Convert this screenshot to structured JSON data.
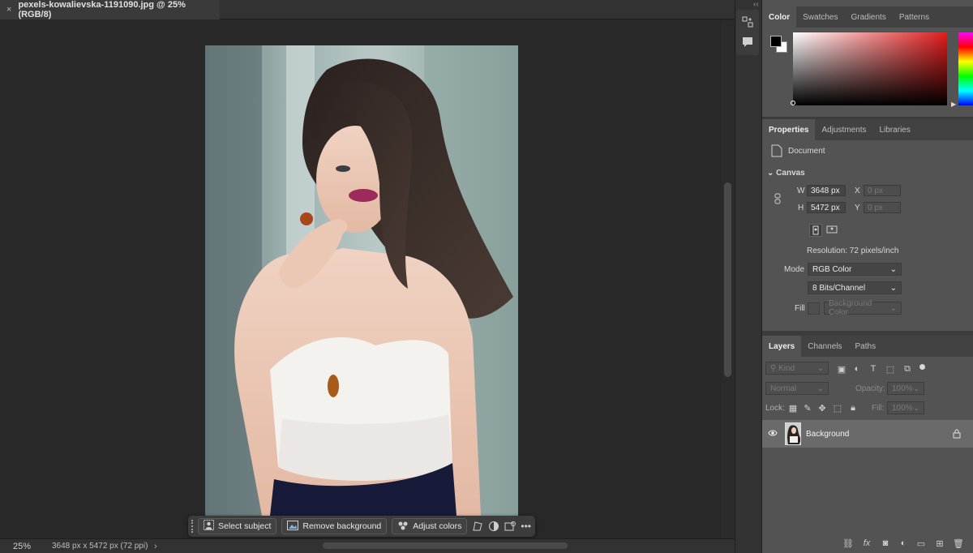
{
  "document_tab": {
    "close_glyph": "×",
    "title": "pexels-kowalievska-1191090.jpg @ 25% (RGB/8)"
  },
  "taskbar": {
    "select_subject": "Select subject",
    "remove_background": "Remove background",
    "adjust_colors": "Adjust colors",
    "more": "•••"
  },
  "statusbar": {
    "zoom": "25%",
    "doc_info": "3648 px x 5472 px (72 ppi)",
    "arrow": "›"
  },
  "color_panel": {
    "tabs": [
      "Color",
      "Swatches",
      "Gradients",
      "Patterns"
    ],
    "hue_color": "#e21c1c"
  },
  "properties_panel": {
    "tabs": [
      "Properties",
      "Adjustments",
      "Libraries"
    ],
    "type_label": "Document",
    "section": "Canvas",
    "w_label": "W",
    "w_value": "3648 px",
    "h_label": "H",
    "h_value": "5472 px",
    "x_label": "X",
    "x_placeholder": "0 px",
    "y_label": "Y",
    "y_placeholder": "0 px",
    "resolution": "Resolution: 72 pixels/inch",
    "mode_label": "Mode",
    "mode_value": "RGB Color",
    "bits_value": "8 Bits/Channel",
    "fill_label": "Fill",
    "fill_value": "Background Color"
  },
  "layers_panel": {
    "tabs": [
      "Layers",
      "Channels",
      "Paths"
    ],
    "kind_placeholder": "Kind",
    "blend_mode": "Normal",
    "opacity_label": "Opacity:",
    "opacity_value": "100%",
    "lock_label": "Lock:",
    "fill_label": "Fill:",
    "fill_value": "100%",
    "layers": [
      {
        "name": "Background",
        "locked": true,
        "visible": true
      }
    ]
  }
}
